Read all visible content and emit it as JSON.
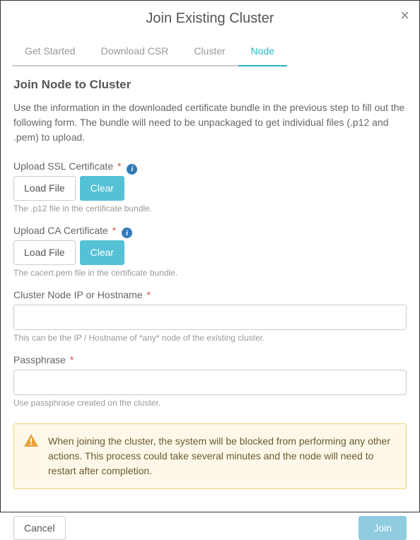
{
  "modal": {
    "title": "Join Existing Cluster"
  },
  "tabs": [
    {
      "label": "Get Started",
      "active": false
    },
    {
      "label": "Download CSR",
      "active": false
    },
    {
      "label": "Cluster",
      "active": false
    },
    {
      "label": "Node",
      "active": true
    }
  ],
  "section": {
    "title": "Join Node to Cluster",
    "description": "Use the information in the downloaded certificate bundle in the previous step to fill out the following form. The bundle will need to be unpackaged to get individual files (.p12 and .pem) to upload."
  },
  "ssl": {
    "label": "Upload SSL Certificate",
    "load_label": "Load File",
    "clear_label": "Clear",
    "hint": "The .p12 file in the certificate bundle."
  },
  "ca": {
    "label": "Upload CA Certificate",
    "load_label": "Load File",
    "clear_label": "Clear",
    "hint": "The cacert.pem file in the certificate bundle."
  },
  "hostname": {
    "label": "Cluster Node IP or Hostname",
    "value": "",
    "hint": "This can be the IP / Hostname of *any* node of the existing cluster."
  },
  "passphrase": {
    "label": "Passphrase",
    "value": "",
    "hint": "Use passphrase created on the cluster."
  },
  "alert": {
    "text": "When joining the cluster, the system will be blocked from performing any other actions. This process could take several minutes and the node will need to restart after completion."
  },
  "footer": {
    "cancel_label": "Cancel",
    "join_label": "Join"
  },
  "asterisk": "*",
  "info_glyph": "i"
}
